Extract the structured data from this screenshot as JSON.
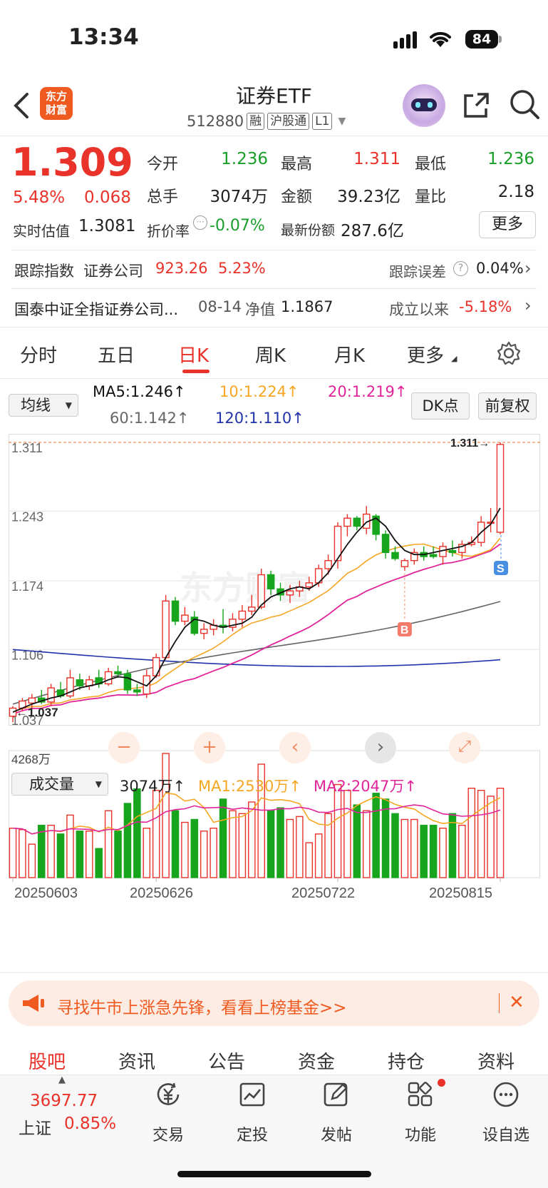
{
  "status": {
    "time": "13:34",
    "battery": "84"
  },
  "header": {
    "title": "证券ETF",
    "code": "512880",
    "tags": [
      "融",
      "沪股通",
      "L1"
    ],
    "logo_line1": "东方",
    "logo_line2": "财富"
  },
  "quote": {
    "price": "1.309",
    "change_pct": "5.48%",
    "change": "0.068",
    "open_label": "今开",
    "open": "1.236",
    "high_label": "最高",
    "high": "1.311",
    "low_label": "最低",
    "low": "1.236",
    "volume_label": "总手",
    "volume": "3074万",
    "amount_label": "金额",
    "amount": "39.23亿",
    "ratio_label": "量比",
    "ratio": "2.18",
    "iopv_label": "实时估值",
    "iopv": "1.3081",
    "discount_label": "折价率",
    "discount": "-0.07%",
    "shares_label": "最新份额",
    "shares": "287.6亿",
    "more_button": "更多"
  },
  "tracking": {
    "label": "跟踪指数",
    "index": "证券公司",
    "value": "923.26",
    "pct": "5.23%",
    "error_label": "跟踪误差",
    "error": "0.04%"
  },
  "fund": {
    "name": "国泰中证全指证券公司...",
    "nav_date": "08-14",
    "nav_label": "净值",
    "nav": "1.1867",
    "since_label": "成立以来",
    "since": "-5.18%"
  },
  "tabs": [
    "分时",
    "五日",
    "日K",
    "周K",
    "月K",
    "更多"
  ],
  "active_tab": 2,
  "ma": {
    "selector": "均线",
    "ma5": "MA5:1.246",
    "ma10": "10:1.224",
    "ma20": "20:1.219",
    "ma60": "60:1.142",
    "ma120": "120:1.110",
    "dk_button": "DK点",
    "adjust_button": "前复权"
  },
  "price_axis": [
    "1.311",
    "1.243",
    "1.174",
    "1.106",
    "1.037"
  ],
  "last_label": "1.311",
  "low_label": "1.037",
  "markers": {
    "buy": "B",
    "sell": "S"
  },
  "volume": {
    "selector": "成交量",
    "value": "3074万",
    "ma1": "MA1:2530万",
    "ma2": "MA2:2047万",
    "max_label": "4268万"
  },
  "dates": [
    "20250603",
    "20250626",
    "20250722",
    "20250815"
  ],
  "colors": {
    "up": "#e8322a",
    "down": "#16a51c",
    "ma5": "#111111",
    "ma10": "#f5a623",
    "ma20": "#e0249a",
    "ma60": "#666666",
    "ma120": "#2233aa"
  },
  "chart_data": {
    "type": "candlestick",
    "ylim": [
      1.037,
      1.311
    ],
    "candles": [
      {
        "o": 1.04,
        "h": 1.05,
        "l": 1.034,
        "c": 1.048
      },
      {
        "o": 1.048,
        "h": 1.058,
        "l": 1.045,
        "c": 1.055
      },
      {
        "o": 1.053,
        "h": 1.062,
        "l": 1.048,
        "c": 1.058
      },
      {
        "o": 1.058,
        "h": 1.066,
        "l": 1.052,
        "c": 1.054
      },
      {
        "o": 1.054,
        "h": 1.072,
        "l": 1.05,
        "c": 1.068
      },
      {
        "o": 1.066,
        "h": 1.074,
        "l": 1.058,
        "c": 1.06
      },
      {
        "o": 1.06,
        "h": 1.086,
        "l": 1.058,
        "c": 1.078
      },
      {
        "o": 1.076,
        "h": 1.082,
        "l": 1.066,
        "c": 1.07
      },
      {
        "o": 1.07,
        "h": 1.08,
        "l": 1.066,
        "c": 1.076
      },
      {
        "o": 1.078,
        "h": 1.086,
        "l": 1.068,
        "c": 1.072
      },
      {
        "o": 1.072,
        "h": 1.088,
        "l": 1.07,
        "c": 1.084
      },
      {
        "o": 1.084,
        "h": 1.09,
        "l": 1.078,
        "c": 1.082
      },
      {
        "o": 1.082,
        "h": 1.086,
        "l": 1.062,
        "c": 1.066
      },
      {
        "o": 1.066,
        "h": 1.072,
        "l": 1.06,
        "c": 1.064
      },
      {
        "o": 1.062,
        "h": 1.086,
        "l": 1.058,
        "c": 1.08
      },
      {
        "o": 1.08,
        "h": 1.102,
        "l": 1.078,
        "c": 1.098
      },
      {
        "o": 1.098,
        "h": 1.16,
        "l": 1.096,
        "c": 1.154
      },
      {
        "o": 1.154,
        "h": 1.158,
        "l": 1.13,
        "c": 1.134
      },
      {
        "o": 1.134,
        "h": 1.148,
        "l": 1.13,
        "c": 1.14
      },
      {
        "o": 1.138,
        "h": 1.144,
        "l": 1.12,
        "c": 1.122
      },
      {
        "o": 1.122,
        "h": 1.132,
        "l": 1.116,
        "c": 1.126
      },
      {
        "o": 1.126,
        "h": 1.136,
        "l": 1.12,
        "c": 1.13
      },
      {
        "o": 1.13,
        "h": 1.146,
        "l": 1.122,
        "c": 1.128
      },
      {
        "o": 1.128,
        "h": 1.142,
        "l": 1.124,
        "c": 1.136
      },
      {
        "o": 1.136,
        "h": 1.15,
        "l": 1.128,
        "c": 1.144
      },
      {
        "o": 1.144,
        "h": 1.16,
        "l": 1.14,
        "c": 1.148
      },
      {
        "o": 1.148,
        "h": 1.186,
        "l": 1.146,
        "c": 1.18
      },
      {
        "o": 1.18,
        "h": 1.184,
        "l": 1.16,
        "c": 1.166
      },
      {
        "o": 1.166,
        "h": 1.172,
        "l": 1.154,
        "c": 1.16
      },
      {
        "o": 1.16,
        "h": 1.17,
        "l": 1.152,
        "c": 1.164
      },
      {
        "o": 1.164,
        "h": 1.174,
        "l": 1.158,
        "c": 1.168
      },
      {
        "o": 1.168,
        "h": 1.178,
        "l": 1.164,
        "c": 1.172
      },
      {
        "o": 1.172,
        "h": 1.19,
        "l": 1.168,
        "c": 1.186
      },
      {
        "o": 1.186,
        "h": 1.2,
        "l": 1.18,
        "c": 1.194
      },
      {
        "o": 1.194,
        "h": 1.232,
        "l": 1.186,
        "c": 1.228
      },
      {
        "o": 1.228,
        "h": 1.24,
        "l": 1.218,
        "c": 1.236
      },
      {
        "o": 1.236,
        "h": 1.238,
        "l": 1.224,
        "c": 1.228
      },
      {
        "o": 1.226,
        "h": 1.248,
        "l": 1.22,
        "c": 1.24
      },
      {
        "o": 1.238,
        "h": 1.24,
        "l": 1.214,
        "c": 1.22
      },
      {
        "o": 1.22,
        "h": 1.224,
        "l": 1.196,
        "c": 1.202
      },
      {
        "o": 1.202,
        "h": 1.208,
        "l": 1.194,
        "c": 1.196
      },
      {
        "o": 1.188,
        "h": 1.196,
        "l": 1.184,
        "c": 1.194
      },
      {
        "o": 1.194,
        "h": 1.206,
        "l": 1.19,
        "c": 1.202
      },
      {
        "o": 1.202,
        "h": 1.208,
        "l": 1.194,
        "c": 1.198
      },
      {
        "o": 1.2,
        "h": 1.208,
        "l": 1.196,
        "c": 1.198
      },
      {
        "o": 1.198,
        "h": 1.212,
        "l": 1.19,
        "c": 1.208
      },
      {
        "o": 1.204,
        "h": 1.214,
        "l": 1.198,
        "c": 1.202
      },
      {
        "o": 1.202,
        "h": 1.214,
        "l": 1.196,
        "c": 1.21
      },
      {
        "o": 1.21,
        "h": 1.218,
        "l": 1.208,
        "c": 1.212
      },
      {
        "o": 1.212,
        "h": 1.238,
        "l": 1.208,
        "c": 1.232
      },
      {
        "o": 1.232,
        "h": 1.246,
        "l": 1.222,
        "c": 1.232
      },
      {
        "o": 1.222,
        "h": 1.311,
        "l": 1.22,
        "c": 1.309
      }
    ],
    "volumes": [
      1700,
      1650,
      1150,
      1800,
      1800,
      1500,
      2150,
      1600,
      1600,
      1000,
      2300,
      1600,
      2550,
      3050,
      1700,
      3000,
      4268,
      2300,
      1900,
      2000,
      1600,
      1700,
      2700,
      2300,
      2200,
      2600,
      3900,
      2300,
      2400,
      2000,
      2100,
      1200,
      1500,
      2200,
      3200,
      3000,
      2500,
      2300,
      2900,
      2700,
      2200,
      2000,
      2000,
      1800,
      1800,
      1700,
      2200,
      1800,
      3074,
      3000,
      2800,
      3074
    ],
    "ma5_values": [
      1.044,
      1.048,
      1.052,
      1.055,
      1.058,
      1.06,
      1.064,
      1.068,
      1.07,
      1.072,
      1.076,
      1.079,
      1.078,
      1.074,
      1.07,
      1.08,
      1.098,
      1.114,
      1.128,
      1.136,
      1.134,
      1.13,
      1.128,
      1.13,
      1.132,
      1.138,
      1.15,
      1.158,
      1.162,
      1.166,
      1.168,
      1.166,
      1.172,
      1.182,
      1.196,
      1.21,
      1.222,
      1.232,
      1.236,
      1.228,
      1.214,
      1.204,
      1.2,
      1.2,
      1.202,
      1.204,
      1.206,
      1.208,
      1.212,
      1.222,
      1.23,
      1.246
    ]
  },
  "banner": {
    "text": "寻找牛市上涨急先锋，看看上榜基金>>"
  },
  "bottom_tabs": [
    "股吧",
    "资讯",
    "公告",
    "资金",
    "持仓",
    "资料"
  ],
  "index_quote": {
    "value": "3697.77",
    "name": "上证",
    "pct": "0.85%"
  },
  "toolbar": [
    "交易",
    "定投",
    "发帖",
    "功能",
    "设自选"
  ]
}
